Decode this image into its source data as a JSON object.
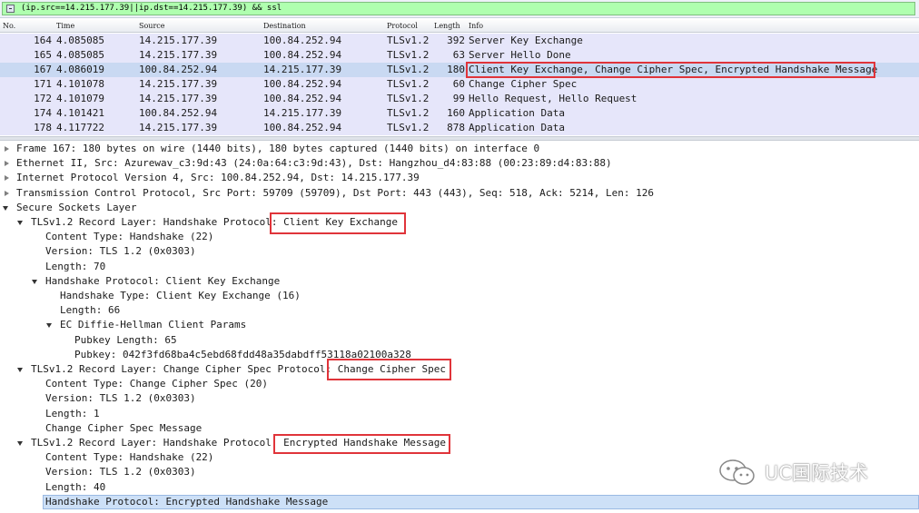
{
  "filter": {
    "value": "(ip.src==14.215.177.39||ip.dst==14.215.177.39) && ssl"
  },
  "columns": {
    "no": "No.",
    "time": "Time",
    "source": "Source",
    "destination": "Destination",
    "protocol": "Protocol",
    "length": "Length",
    "info": "Info"
  },
  "packets": [
    {
      "no": "164",
      "time": "4.085085",
      "src": "14.215.177.39",
      "dst": "100.84.252.94",
      "proto": "TLSv1.2",
      "len": "392",
      "info": "Server Key Exchange"
    },
    {
      "no": "165",
      "time": "4.085085",
      "src": "14.215.177.39",
      "dst": "100.84.252.94",
      "proto": "TLSv1.2",
      "len": "63",
      "info": "Server Hello Done"
    },
    {
      "no": "167",
      "time": "4.086019",
      "src": "100.84.252.94",
      "dst": "14.215.177.39",
      "proto": "TLSv1.2",
      "len": "180",
      "info": "Client Key Exchange, Change Cipher Spec, Encrypted Handshake Message",
      "selected": true
    },
    {
      "no": "171",
      "time": "4.101078",
      "src": "14.215.177.39",
      "dst": "100.84.252.94",
      "proto": "TLSv1.2",
      "len": "60",
      "info": "Change Cipher Spec"
    },
    {
      "no": "172",
      "time": "4.101079",
      "src": "14.215.177.39",
      "dst": "100.84.252.94",
      "proto": "TLSv1.2",
      "len": "99",
      "info": "Hello Request, Hello Request"
    },
    {
      "no": "174",
      "time": "4.101421",
      "src": "100.84.252.94",
      "dst": "14.215.177.39",
      "proto": "TLSv1.2",
      "len": "160",
      "info": "Application Data"
    },
    {
      "no": "178",
      "time": "4.117722",
      "src": "14.215.177.39",
      "dst": "100.84.252.94",
      "proto": "TLSv1.2",
      "len": "878",
      "info": "Application Data"
    }
  ],
  "details": [
    {
      "text": "Frame 167: 180 bytes on wire (1440 bits), 180 bytes captured (1440 bits) on interface 0",
      "level": 0,
      "arrow": "right"
    },
    {
      "text": "Ethernet II, Src: Azurewav_c3:9d:43 (24:0a:64:c3:9d:43), Dst: Hangzhou_d4:83:88 (00:23:89:d4:83:88)",
      "level": 0,
      "arrow": "right"
    },
    {
      "text": "Internet Protocol Version 4, Src: 100.84.252.94, Dst: 14.215.177.39",
      "level": 0,
      "arrow": "right"
    },
    {
      "text": "Transmission Control Protocol, Src Port: 59709 (59709), Dst Port: 443 (443), Seq: 518, Ack: 5214, Len: 126",
      "level": 0,
      "arrow": "right"
    },
    {
      "text": "Secure Sockets Layer",
      "level": 0,
      "arrow": "down"
    },
    {
      "text": "TLSv1.2 Record Layer: Handshake Protocol: Client Key Exchange",
      "level": 1,
      "arrow": "down"
    },
    {
      "text": "Content Type: Handshake (22)",
      "level": 2,
      "arrow": ""
    },
    {
      "text": "Version: TLS 1.2 (0x0303)",
      "level": 2,
      "arrow": ""
    },
    {
      "text": "Length: 70",
      "level": 2,
      "arrow": ""
    },
    {
      "text": "Handshake Protocol: Client Key Exchange",
      "level": 2,
      "arrow": "down"
    },
    {
      "text": "Handshake Type: Client Key Exchange (16)",
      "level": 3,
      "arrow": ""
    },
    {
      "text": "Length: 66",
      "level": 3,
      "arrow": ""
    },
    {
      "text": "EC Diffie-Hellman Client Params",
      "level": 3,
      "arrow": "down"
    },
    {
      "text": "Pubkey Length: 65",
      "level": 4,
      "arrow": ""
    },
    {
      "text": "Pubkey: 042f3fd68ba4c5ebd68fdd48a35dabdff53118a02100a328",
      "level": 4,
      "arrow": ""
    },
    {
      "text": "TLSv1.2 Record Layer: Change Cipher Spec Protocol: Change Cipher Spec",
      "level": 1,
      "arrow": "down"
    },
    {
      "text": "Content Type: Change Cipher Spec (20)",
      "level": 2,
      "arrow": ""
    },
    {
      "text": "Version: TLS 1.2 (0x0303)",
      "level": 2,
      "arrow": ""
    },
    {
      "text": "Length: 1",
      "level": 2,
      "arrow": ""
    },
    {
      "text": "Change Cipher Spec Message",
      "level": 2,
      "arrow": ""
    },
    {
      "text": "TLSv1.2 Record Layer: Handshake Protocol: Encrypted Handshake Message",
      "level": 1,
      "arrow": "down"
    },
    {
      "text": "Content Type: Handshake (22)",
      "level": 2,
      "arrow": ""
    },
    {
      "text": "Version: TLS 1.2 (0x0303)",
      "level": 2,
      "arrow": ""
    },
    {
      "text": "Length: 40",
      "level": 2,
      "arrow": ""
    },
    {
      "text": "Handshake Protocol: Encrypted Handshake Message",
      "level": 2,
      "arrow": "",
      "selected": true
    }
  ],
  "watermark": {
    "text": "UC国际技术",
    "icon": "wechat-icon"
  },
  "colors": {
    "filter_bg": "#afffaf",
    "row_bg": "#e6e6fa",
    "highlight": "#e0343a"
  }
}
